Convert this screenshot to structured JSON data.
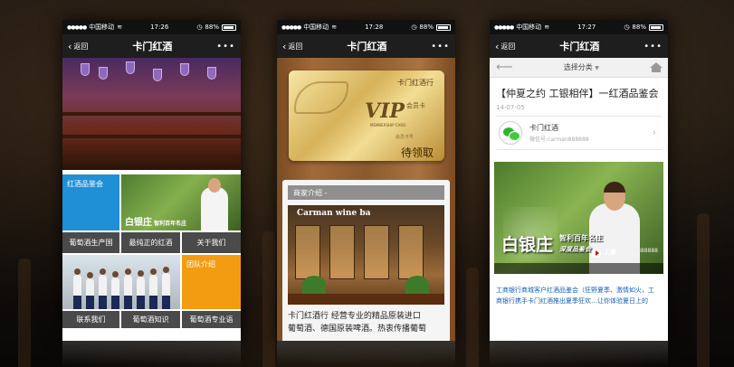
{
  "status": {
    "carrier": "中国移动",
    "battery": "88%",
    "time_1": "17:26",
    "time_2": "17:28",
    "time_3": "17:27"
  },
  "nav": {
    "back_label": "返回",
    "title": "卡门红酒",
    "more_label": "•••"
  },
  "phone1": {
    "tiles": {
      "wine_tasting": "红酒品鉴会",
      "vineyard": "葡萄酒生产国",
      "pure_wine": "最纯正的红酒",
      "about_us": "关于我们",
      "team_intro": "团队介绍",
      "contact_us": "联系我们",
      "wine_knowledge": "葡萄酒知识",
      "wine_terms": "葡萄酒专业语"
    },
    "photo_tile_big": "白银庄",
    "photo_tile_small": "智利百年名庄"
  },
  "phone2": {
    "card": {
      "brand": "卡门红酒行",
      "vip_text": "VIP",
      "member_label": "会员卡",
      "sub_text": "MEMBERSHIP CARD",
      "number_label": "会员卡号",
      "status": "待领取"
    },
    "intro_header": "商家介绍 -",
    "intro_sign": "Carman wine ba",
    "intro_text_line1": "卡门红酒行 经营专业的精品原装进口",
    "intro_text_line2": "葡萄酒、德国原装啤酒。热衷传播葡萄"
  },
  "phone3": {
    "category_label": "选择分类",
    "article_title": "【仲夏之约 工银相伴】一红酒品鉴会",
    "article_date": "14-07-05",
    "account_name": "卡门红酒",
    "account_id": "微信号:carman888888",
    "ad_big": "白银庄",
    "ad_sub1": "智利百年名庄",
    "ad_sub2": "深度品鉴会",
    "ad_live": "上演",
    "ad_id": "an888888",
    "footer_line1": "工商银行商城客户红酒品鉴会（狂野夏季、激情如火，工",
    "footer_line2": "商银行携手卡门红酒推出夏季狂欢…让你体验夏日上的"
  },
  "colors": {
    "tile_blue": "#1f8fd6",
    "tile_orange": "#f39c12",
    "tile_gray": "#4a4a4a",
    "link_blue": "#1a5fb4"
  }
}
